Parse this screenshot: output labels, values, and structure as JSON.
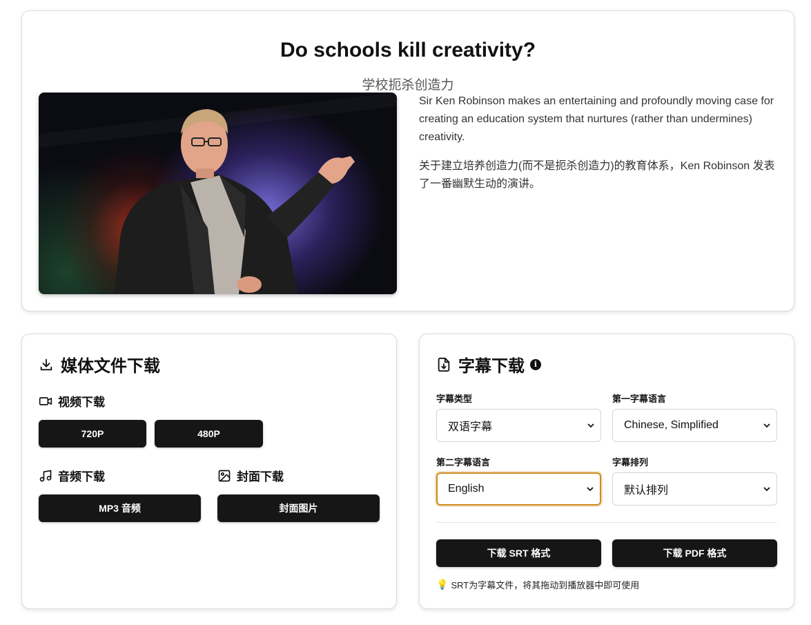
{
  "talk": {
    "title": "Do schools kill creativity?",
    "title_zh": "学校扼杀创造力",
    "description_en": "Sir Ken Robinson makes an entertaining and profoundly moving case for creating an education system that nurtures (rather than undermines) creativity.",
    "description_zh": "关于建立培养创造力(而不是扼杀创造力)的教育体系，Ken Robinson 发表了一番幽默生动的演讲。"
  },
  "media": {
    "heading": "媒体文件下载",
    "video_label": "视频下载",
    "video_buttons": [
      "720P",
      "480P"
    ],
    "audio_label": "音频下载",
    "audio_button": "MP3 音频",
    "cover_label": "封面下载",
    "cover_button": "封面图片"
  },
  "subtitles": {
    "heading": "字幕下载",
    "type_label": "字幕类型",
    "type_value": "双语字幕",
    "first_lang_label": "第一字幕语言",
    "first_lang_value": "Chinese, Simplified",
    "second_lang_label": "第二字幕语言",
    "second_lang_value": "English",
    "order_label": "字幕排列",
    "order_value": "默认排列",
    "srt_button": "下载 SRT 格式",
    "pdf_button": "下载 PDF 格式",
    "hint": "SRT为字幕文件，将其拖动到播放器中即可使用"
  },
  "colors": {
    "button_bg": "#161616",
    "focus_border": "#d08a1c"
  }
}
